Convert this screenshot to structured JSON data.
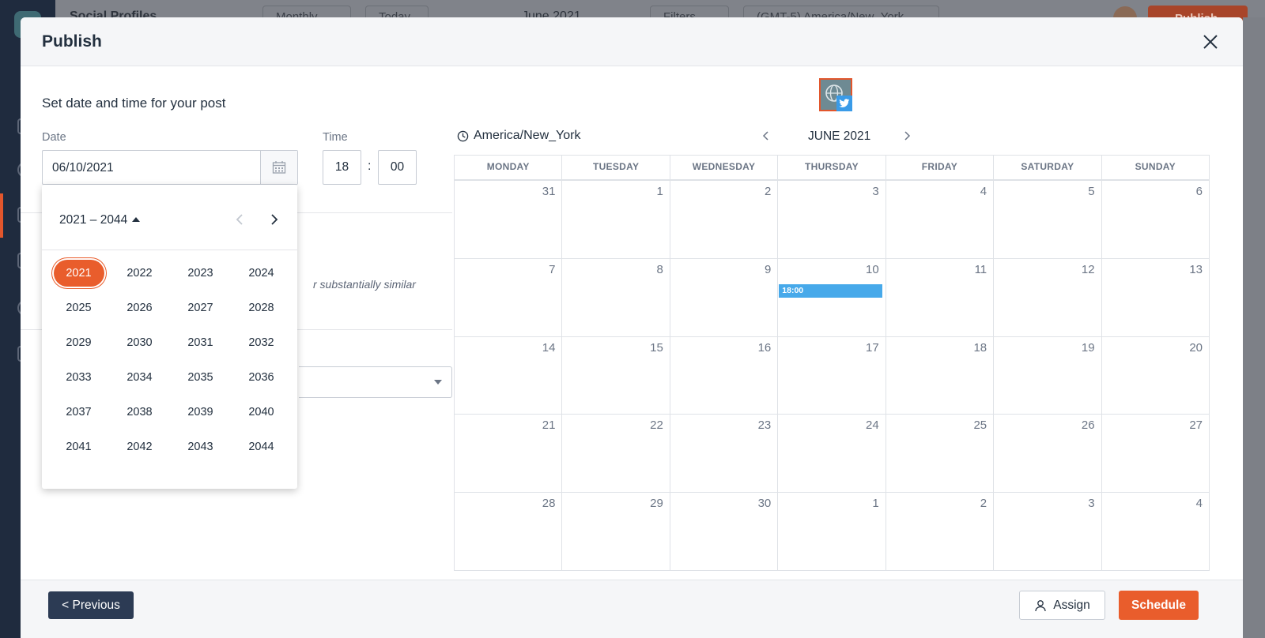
{
  "background": {
    "title": "Social Profiles",
    "view_select": "Monthly",
    "today_button": "Today",
    "month_label": "June 2021",
    "filters_button": "Filters",
    "timezone_select": "(GMT-5) America/New_York",
    "publish_button": "Publish"
  },
  "modal": {
    "title": "Publish",
    "close_icon": "close-icon"
  },
  "schedule_form": {
    "heading": "Set date and time for your post",
    "date_label": "Date",
    "date_value": "06/10/2021",
    "time_label": "Time",
    "hour_value": "18",
    "time_separator": ":",
    "minute_value": "00",
    "hint_partial": "r substantially similar"
  },
  "year_picker": {
    "range_label": "2021 – 2044",
    "selected_year": "2021",
    "years": [
      "2021",
      "2022",
      "2023",
      "2024",
      "2025",
      "2026",
      "2027",
      "2028",
      "2029",
      "2030",
      "2031",
      "2032",
      "2033",
      "2034",
      "2035",
      "2036",
      "2037",
      "2038",
      "2039",
      "2040",
      "2041",
      "2042",
      "2043",
      "2044"
    ]
  },
  "calendar": {
    "profile_network": "twitter",
    "timezone": "America/New_York",
    "month_label": "JUNE 2021",
    "weekdays": [
      "MONDAY",
      "TUESDAY",
      "WEDNESDAY",
      "THURSDAY",
      "FRIDAY",
      "SATURDAY",
      "SUNDAY"
    ],
    "days": [
      "31",
      "1",
      "2",
      "3",
      "4",
      "5",
      "6",
      "7",
      "8",
      "9",
      "10",
      "11",
      "12",
      "13",
      "14",
      "15",
      "16",
      "17",
      "18",
      "19",
      "20",
      "21",
      "22",
      "23",
      "24",
      "25",
      "26",
      "27",
      "28",
      "29",
      "30",
      "1",
      "2",
      "3",
      "4"
    ],
    "events": [
      {
        "day_index": 10,
        "label": "18:00",
        "color": "#47a9ea"
      }
    ]
  },
  "footer": {
    "previous_button": "< Previous",
    "assign_button": "Assign",
    "schedule_button": "Schedule"
  },
  "colors": {
    "accent": "#e95d2c",
    "navy": "#2c3b54",
    "event_blue": "#47a9ea"
  }
}
